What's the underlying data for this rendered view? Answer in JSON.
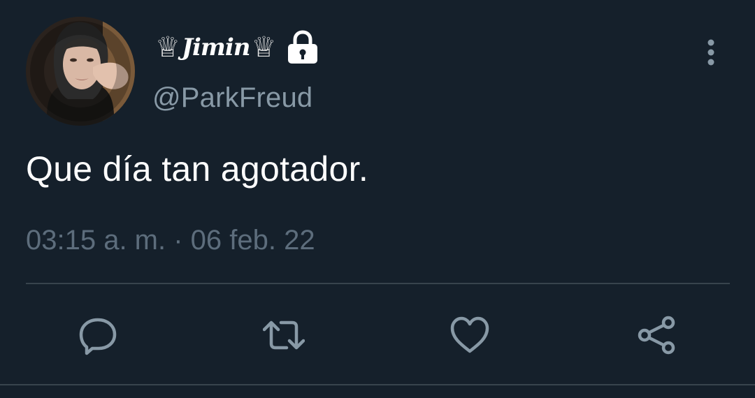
{
  "tweet": {
    "display_name": "Jimin",
    "crown_glyph": "♕",
    "handle": "@ParkFreud",
    "text": "Que día tan agotador.",
    "timestamp": "03:15 a. m. · 06 feb. 22",
    "protected": true
  },
  "icons": {
    "avatar": "profile-photo",
    "lock": "lock-icon",
    "more": "more-vertical-icon",
    "reply": "reply-icon",
    "retweet": "retweet-icon",
    "like": "heart-icon",
    "share": "share-icon"
  },
  "colors": {
    "background": "#15202b",
    "primary_text": "#ffffff",
    "secondary_text": "#8899a6",
    "icon": "#8899a6",
    "divider": "#38444d"
  }
}
